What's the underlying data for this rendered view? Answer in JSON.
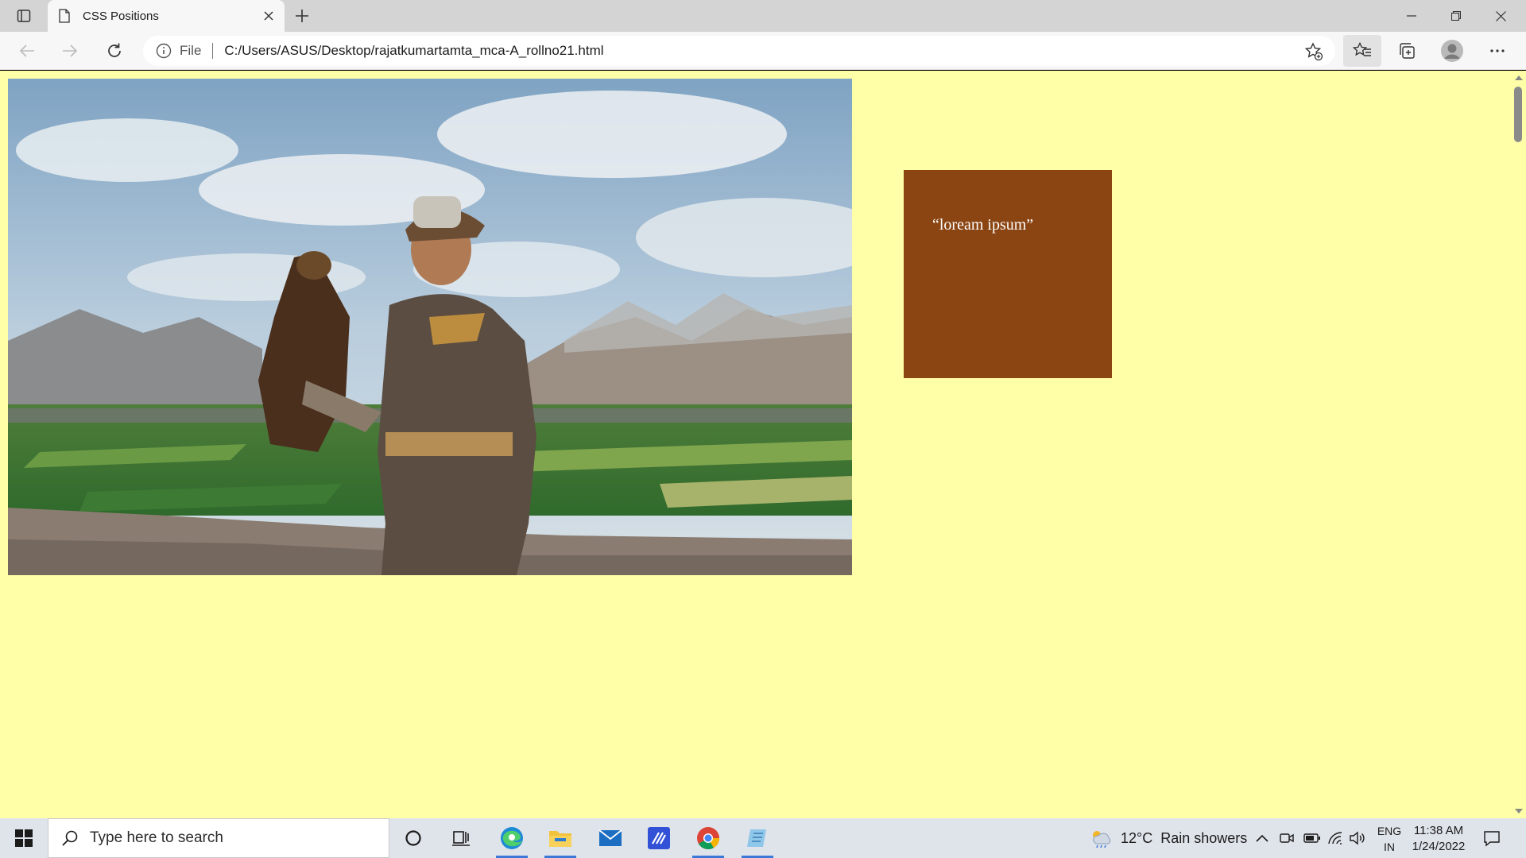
{
  "browser": {
    "tab_title": "CSS Positions",
    "address_prefix": "File",
    "url": "C:/Users/ASUS/Desktop/rajatkumartamta_mca-A_rollno21.html"
  },
  "page": {
    "background": "#ffffa8",
    "box_color": "#8b4513",
    "box_text": "“loream ipsum”",
    "image_subject": "eagle-hunter-photo"
  },
  "taskbar": {
    "search_placeholder": "Type here to search",
    "weather_temp": "12°C",
    "weather_desc": "Rain showers",
    "lang_line1": "ENG",
    "lang_line2": "IN",
    "time": "11:38 AM",
    "date": "1/24/2022"
  }
}
